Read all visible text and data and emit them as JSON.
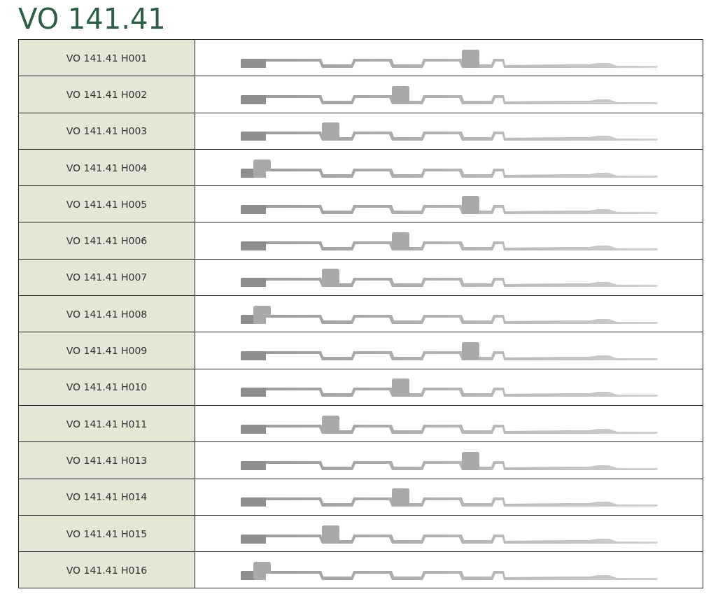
{
  "title": "VO 141.41",
  "rows": [
    {
      "label": "VO 141.41 H001",
      "kind": "fourth"
    },
    {
      "label": "VO 141.41 H002",
      "kind": "third"
    },
    {
      "label": "VO 141.41 H003",
      "kind": "second"
    },
    {
      "label": "VO 141.41 H004",
      "kind": "first"
    },
    {
      "label": "VO 141.41 H005",
      "kind": "fourth"
    },
    {
      "label": "VO 141.41 H006",
      "kind": "third"
    },
    {
      "label": "VO 141.41 H007",
      "kind": "second"
    },
    {
      "label": "VO 141.41 H008",
      "kind": "first"
    },
    {
      "label": "VO 141.41 H009",
      "kind": "fourth"
    },
    {
      "label": "VO 141.41 H010",
      "kind": "third"
    },
    {
      "label": "VO 141.41 H011",
      "kind": "second"
    },
    {
      "label": "VO 141.41 H013",
      "kind": "fourth"
    },
    {
      "label": "VO 141.41 H014",
      "kind": "third"
    },
    {
      "label": "VO 141.41 H015",
      "kind": "second"
    },
    {
      "label": "VO 141.41 H016",
      "kind": "first"
    }
  ]
}
